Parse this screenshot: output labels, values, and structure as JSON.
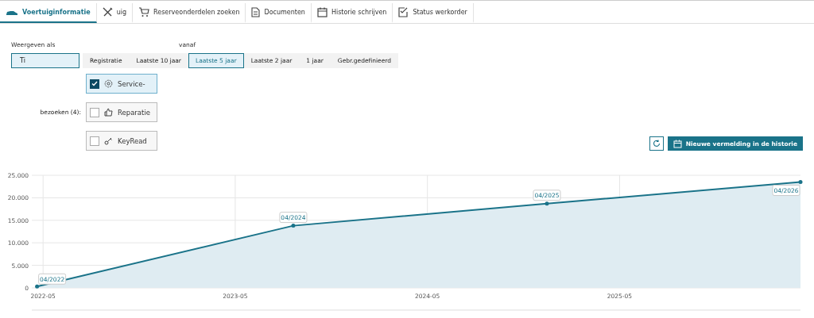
{
  "tabs": [
    {
      "label": "Voertuiginformatie",
      "selected": true
    },
    {
      "label": "uig",
      "selected": false
    },
    {
      "label": "Reserveonderdelen zoeken",
      "selected": false
    },
    {
      "label": "Documenten",
      "selected": false
    },
    {
      "label": "Historie schrijven",
      "selected": false
    },
    {
      "label": "Status werkorder",
      "selected": false
    }
  ],
  "view": {
    "label": "Weergeven als",
    "button": {
      "label": "Ti",
      "selected": true
    }
  },
  "range": {
    "label": "vanaf",
    "options": [
      {
        "label": "Registratie",
        "selected": false
      },
      {
        "label": "Laatste 10 jaar",
        "selected": false
      },
      {
        "label": "Laatste 5 jaar",
        "selected": true
      },
      {
        "label": "Laatste 2 jaar",
        "selected": false
      },
      {
        "label": "1 jaar",
        "selected": false
      },
      {
        "label": "Gebr.gedefinieerd",
        "selected": false
      }
    ]
  },
  "visits": {
    "label": "bezoeken (4):",
    "filters": [
      {
        "label": "Service-",
        "checked": true
      },
      {
        "label": "Reparatie",
        "checked": false
      },
      {
        "label": "KeyRead",
        "checked": false
      }
    ]
  },
  "actions": {
    "new_entry": "Nieuwe vermelding in de historie"
  },
  "chart": {
    "chart_data": {
      "type": "area",
      "x": [
        "2022-04-20",
        "2023-08-20",
        "2024-12-15",
        "2026-04-10"
      ],
      "series": [
        {
          "color": "#1a7389",
          "values": [
            300,
            13800,
            18700,
            23500
          ]
        }
      ],
      "xlim": [
        "2022-04-10",
        "2026-04-10"
      ],
      "grid": true,
      "ylim": [
        0,
        25000
      ],
      "xticks": [
        "2022-05",
        "2023-05",
        "2024-05",
        "2025-05"
      ],
      "yticks": [
        {
          "value": 0,
          "label": "0"
        },
        {
          "value": 5000,
          "label": "5.000"
        },
        {
          "value": 10000,
          "label": "10.000"
        },
        {
          "value": 15000,
          "label": "15.000"
        },
        {
          "value": 20000,
          "label": "20.000"
        },
        {
          "value": 25000,
          "label": "25.000"
        }
      ],
      "annotations": [
        {
          "x": "2022-04-20",
          "y": 300,
          "text": "04/2022"
        },
        {
          "x": "2023-08-20",
          "y": 13800,
          "text": "04/2024"
        },
        {
          "x": "2024-12-15",
          "y": 18700,
          "text": "04/2025"
        },
        {
          "x": "2026-04-10",
          "y": 23500,
          "text": "04/2026"
        }
      ]
    }
  }
}
